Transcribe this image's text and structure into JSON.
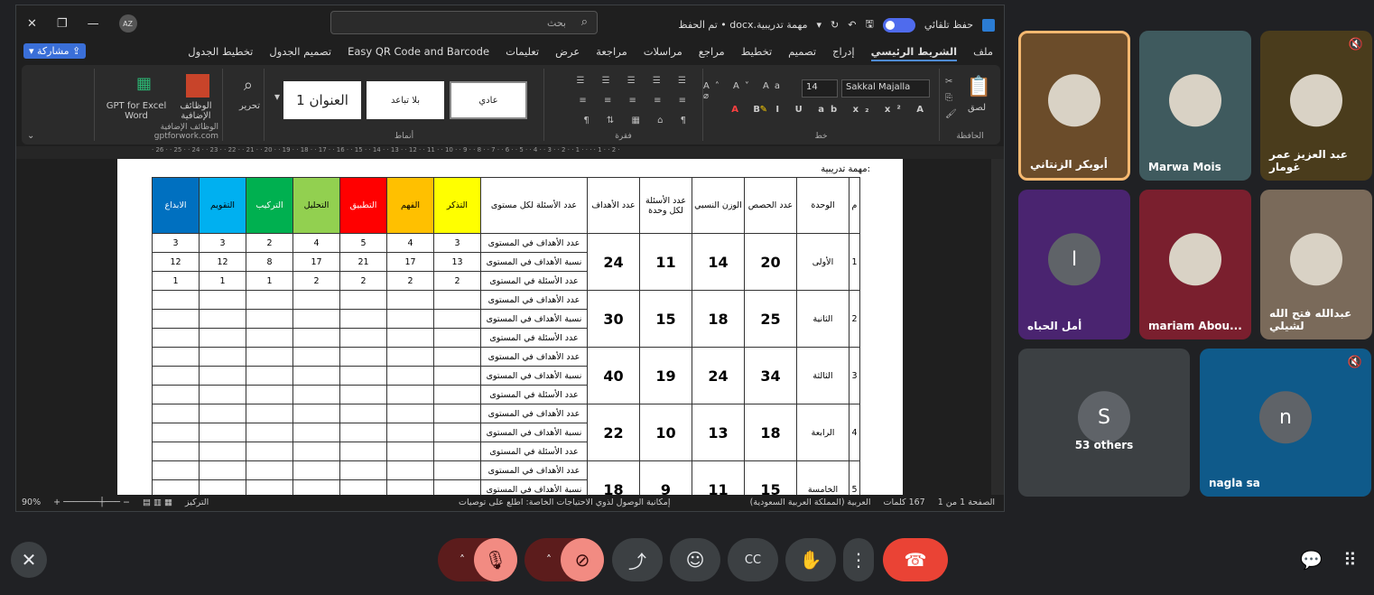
{
  "window": {
    "search_placeholder": "بحث",
    "doc_title": "مهمة تدريبية.docx • تم الحفظ",
    "autosave": "حفظ تلقائي",
    "user_initials": "AZ"
  },
  "tabs": [
    "ملف",
    "الشريط الرئيسي",
    "إدراج",
    "تصميم",
    "تخطيط",
    "مراجع",
    "مراسلات",
    "مراجعة",
    "عرض",
    "تعليمات",
    "Easy QR Code and Barcode",
    "تصميم الجدول",
    "تخطيط الجدول"
  ],
  "share_label": "مشاركة",
  "ribbon": {
    "groups": {
      "clipboard": "الحافظة",
      "font": "خط",
      "paragraph": "فقرة",
      "styles": "أنماط",
      "addins": "الوظائف الإضافية"
    },
    "paste": "لصق",
    "font_name": "Sakkal Majalla",
    "font_size": "14",
    "styles": [
      "عادي",
      "بلا تباعد",
      "العنوان 1"
    ],
    "editing": "تحرير",
    "addins_btn": "الوظائف الإضافية",
    "gpt_btn": "GPT for Excel Word",
    "gpt_site": "gptforwork.com"
  },
  "ruler_text": "· 26 · · 25 · · 24 · · 23 · · 22 · · 21 · · 20 · · 19 · · 18 · · 17 · · 16 · · 15 · · 14 · · 13 · · 12 · · 11 · · 10 · · 9 · · 8 · · 7 · · 6 · · 5 · · 4 · · 3 · · 2 · · 1 · · · · 1 · · 2 ·",
  "document": {
    "heading": "مهمة تدريبية:",
    "headers": {
      "m": "م",
      "unit": "الوحدة",
      "classes": "عدد الحصص",
      "weight": "الوزن النسبي",
      "questions": "عدد الأسئلة لكل وحدة",
      "goals": "عدد الأهداف",
      "per_level": "عدد الأسئلة لكل مستوى"
    },
    "levels": [
      {
        "name": "التذكر",
        "color": "#ffff00"
      },
      {
        "name": "الفهم",
        "color": "#ffc000"
      },
      {
        "name": "التطبيق",
        "color": "#ff0000"
      },
      {
        "name": "التحليل",
        "color": "#92d050"
      },
      {
        "name": "التركيب",
        "color": "#00b050"
      },
      {
        "name": "التقويم",
        "color": "#00b0f0"
      },
      {
        "name": "الابداع",
        "color": "#0070c0"
      }
    ],
    "row_labels": [
      "عدد الأهداف في المستوى",
      "نسبة الأهداف في المستوى",
      "عدد الأسئلة في المستوى"
    ],
    "units": [
      {
        "n": "1",
        "name": "الأولى",
        "classes": "20",
        "weight": "14",
        "questions": "11",
        "goals": "24",
        "values": [
          [
            "3",
            "4",
            "5",
            "4",
            "2",
            "3",
            "3"
          ],
          [
            "13",
            "17",
            "21",
            "17",
            "8",
            "12",
            "12"
          ],
          [
            "2",
            "2",
            "2",
            "2",
            "1",
            "1",
            "1"
          ]
        ]
      },
      {
        "n": "2",
        "name": "الثانية",
        "classes": "25",
        "weight": "18",
        "questions": "15",
        "goals": "30"
      },
      {
        "n": "3",
        "name": "الثالثة",
        "classes": "34",
        "weight": "24",
        "questions": "19",
        "goals": "40"
      },
      {
        "n": "4",
        "name": "الرابعة",
        "classes": "18",
        "weight": "13",
        "questions": "10",
        "goals": "22"
      },
      {
        "n": "5",
        "name": "الخامسة",
        "classes": "15",
        "weight": "11",
        "questions": "9",
        "goals": "18"
      }
    ]
  },
  "status": {
    "page": "الصفحة 1 من 1",
    "words": "167 كلمات",
    "language": "العربية (المملكة العربية السعودية)",
    "accessibility": "إمكانية الوصول لذوي الاحتياجات الخاصة: اطلع على توصيات",
    "focus": "التركيز",
    "zoom": "90%"
  },
  "participants": [
    {
      "name": "أبوبكر الزنتاني",
      "muted": false,
      "bg": "#6b4c2a",
      "active": true
    },
    {
      "name": "Marwa Mois",
      "muted": false,
      "bg": "#3f5a5e"
    },
    {
      "name": "عبد العزيز عمر غومار",
      "muted": true,
      "bg": "#4a3c1c"
    },
    {
      "name": "أمل الحباه",
      "muted": false,
      "bg": "#4a2470",
      "initial": "ا"
    },
    {
      "name": "mariam Abou...",
      "muted": false,
      "bg": "#7a1f2e"
    },
    {
      "name": "عبدالله فتح الله لشيلي",
      "muted": false,
      "bg": "#7a6a5a"
    },
    {
      "name": "53 others",
      "muted": false,
      "bg": "#3c4043",
      "initial": "S"
    },
    {
      "name": "nagla sa",
      "muted": true,
      "bg": "#0f5a8a",
      "initial": "n"
    }
  ],
  "controls": {
    "mic": "mic-off-icon",
    "camera": "camera-off-icon"
  }
}
